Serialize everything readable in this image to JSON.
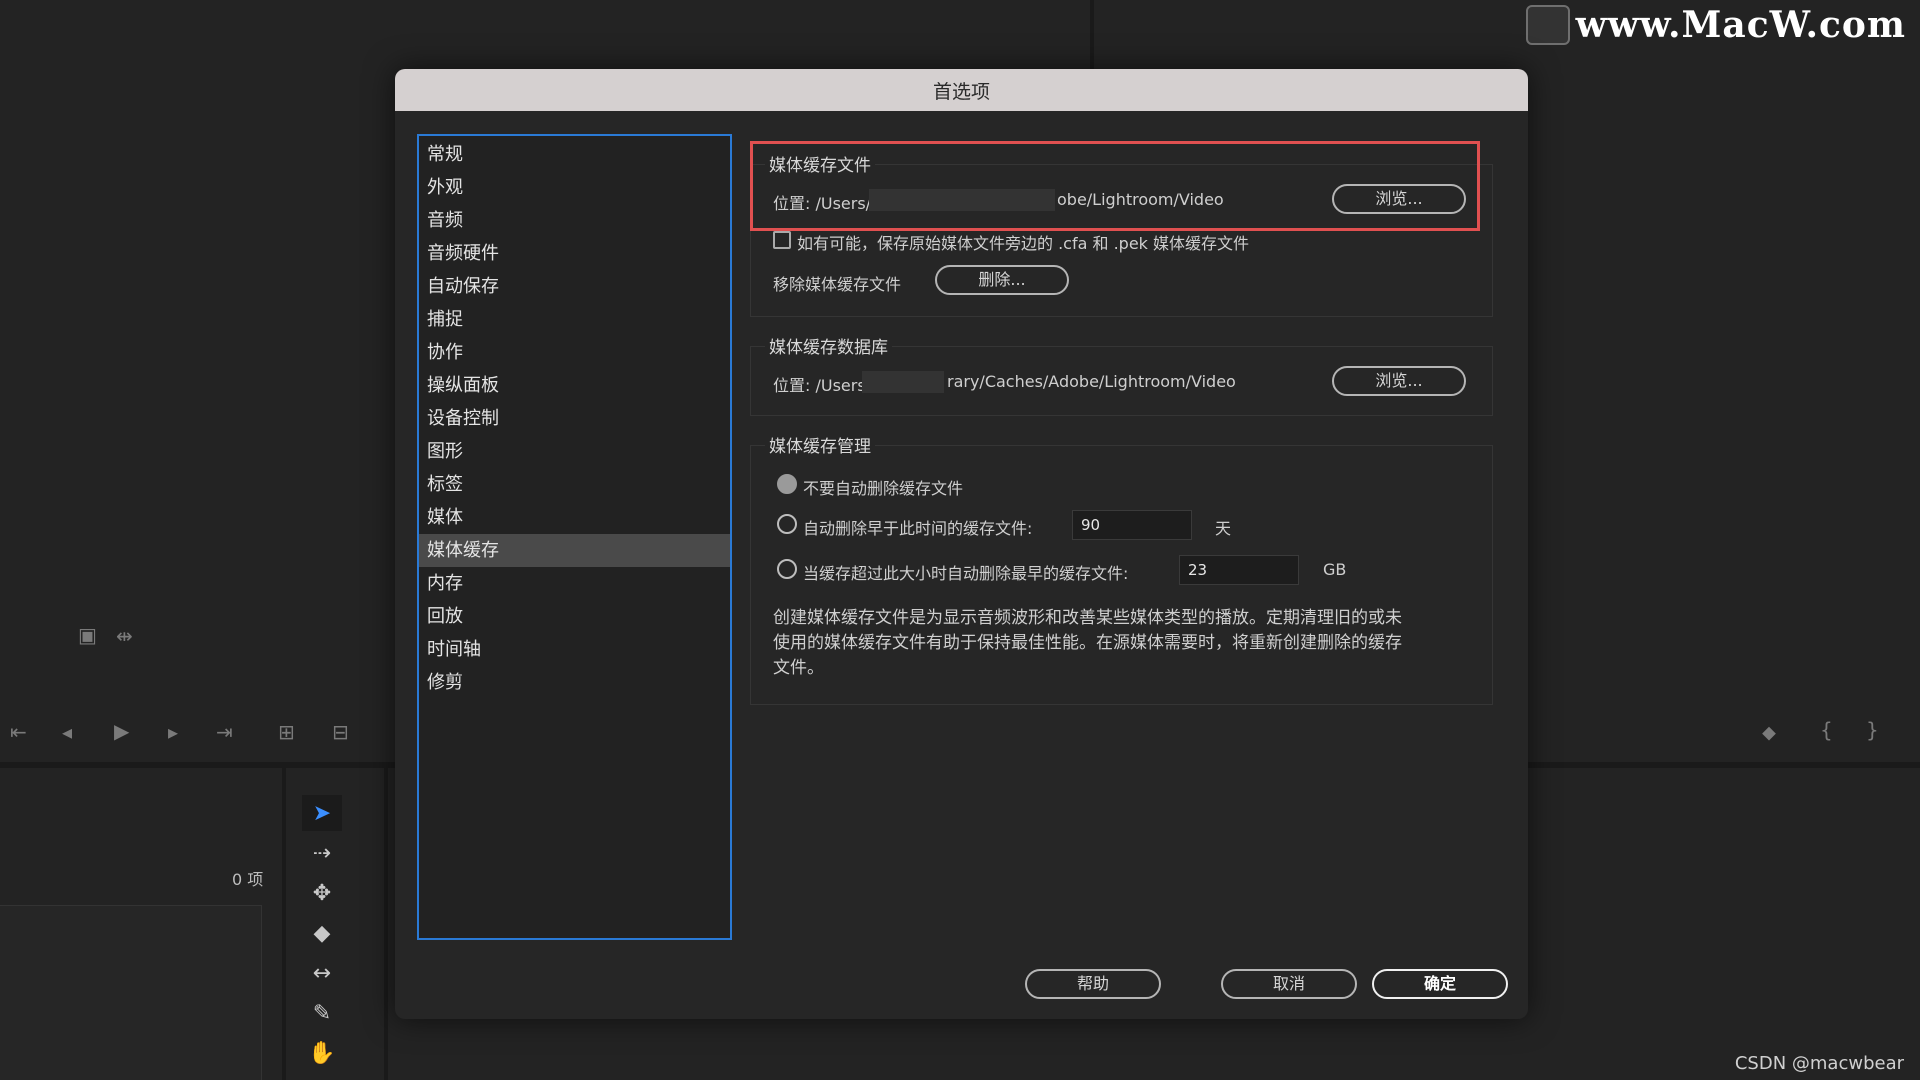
{
  "watermark": {
    "text": "www.MacW.com"
  },
  "credit": "CSDN @macwbear",
  "background": {
    "item_count": "0 项"
  },
  "dialog": {
    "title": "首选项",
    "categories": [
      "常规",
      "外观",
      "音频",
      "音频硬件",
      "自动保存",
      "捕捉",
      "协作",
      "操纵面板",
      "设备控制",
      "图形",
      "标签",
      "媒体",
      "媒体缓存",
      "内存",
      "回放",
      "时间轴",
      "修剪"
    ],
    "selected_category": "媒体缓存",
    "media_cache_files": {
      "title": "媒体缓存文件",
      "location_label": "位置: /Users/",
      "location_tail": "obe/Lightroom/Video",
      "browse_label": "浏览...",
      "checkbox_label": "如有可能，保存原始媒体文件旁边的 .cfa 和 .pek 媒体缓存文件",
      "remove_label": "移除媒体缓存文件",
      "delete_label": "删除..."
    },
    "media_cache_db": {
      "title": "媒体缓存数据库",
      "location_label": "位置: /Users",
      "location_tail": "rary/Caches/Adobe/Lightroom/Video",
      "browse_label": "浏览..."
    },
    "media_cache_mgmt": {
      "title": "媒体缓存管理",
      "option1": "不要自动删除缓存文件",
      "option2": "自动删除早于此时间的缓存文件:",
      "option2_value": "90",
      "option2_unit": "天",
      "option3": "当缓存超过此大小时自动删除最早的缓存文件:",
      "option3_value": "23",
      "option3_unit": "GB",
      "selected_option": 1,
      "description": "创建媒体缓存文件是为显示音频波形和改善某些媒体类型的播放。定期清理旧的或未使用的媒体缓存文件有助于保持最佳性能。在源媒体需要时，将重新创建删除的缓存文件。"
    },
    "buttons": {
      "help": "帮助",
      "cancel": "取消",
      "ok": "确定"
    }
  },
  "colors": {
    "highlight": "#e05050",
    "selection": "#2a7ad6",
    "active_tool": "#3b8fff"
  }
}
